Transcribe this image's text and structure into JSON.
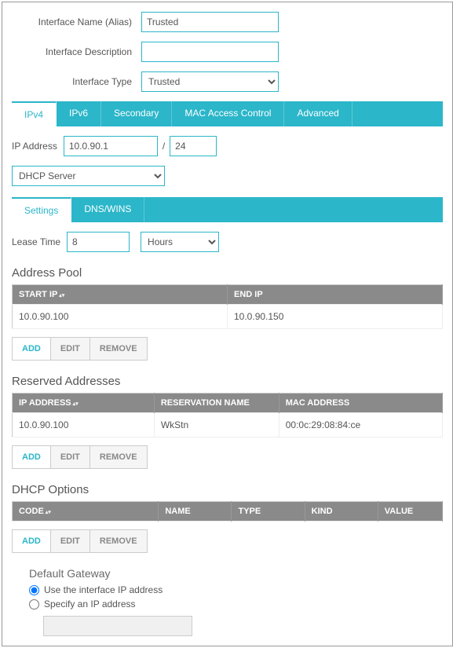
{
  "form": {
    "name_label": "Interface Name (Alias)",
    "name_value": "Trusted",
    "desc_label": "Interface Description",
    "desc_value": "",
    "type_label": "Interface Type",
    "type_value": "Trusted"
  },
  "tabs_main": [
    "IPv4",
    "IPv6",
    "Secondary",
    "MAC Access Control",
    "Advanced"
  ],
  "ip": {
    "label": "IP Address",
    "addr": "10.0.90.1",
    "mask": "24"
  },
  "dhcp_mode": "DHCP Server",
  "tabs_dhcp": [
    "Settings",
    "DNS/WINS"
  ],
  "lease": {
    "label": "Lease Time",
    "value": "8",
    "unit": "Hours"
  },
  "pool": {
    "title": "Address Pool",
    "headers": {
      "start": "Start IP",
      "end": "End IP"
    },
    "row": {
      "start": "10.0.90.100",
      "end": "10.0.90.150"
    }
  },
  "reserved": {
    "title": "Reserved Addresses",
    "headers": {
      "ip": "IP Address",
      "name": "Reservation Name",
      "mac": "MAC Address"
    },
    "row": {
      "ip": "10.0.90.100",
      "name": "WkStn",
      "mac": "00:0c:29:08:84:ce"
    }
  },
  "options": {
    "title": "DHCP Options",
    "headers": {
      "code": "Code",
      "name": "Name",
      "type": "Type",
      "kind": "Kind",
      "value": "Value"
    }
  },
  "buttons": {
    "add": "ADD",
    "edit": "EDIT",
    "remove": "REMOVE"
  },
  "gateway": {
    "title": "Default Gateway",
    "use_if": "Use the interface IP address",
    "spec": "Specify an IP address"
  }
}
